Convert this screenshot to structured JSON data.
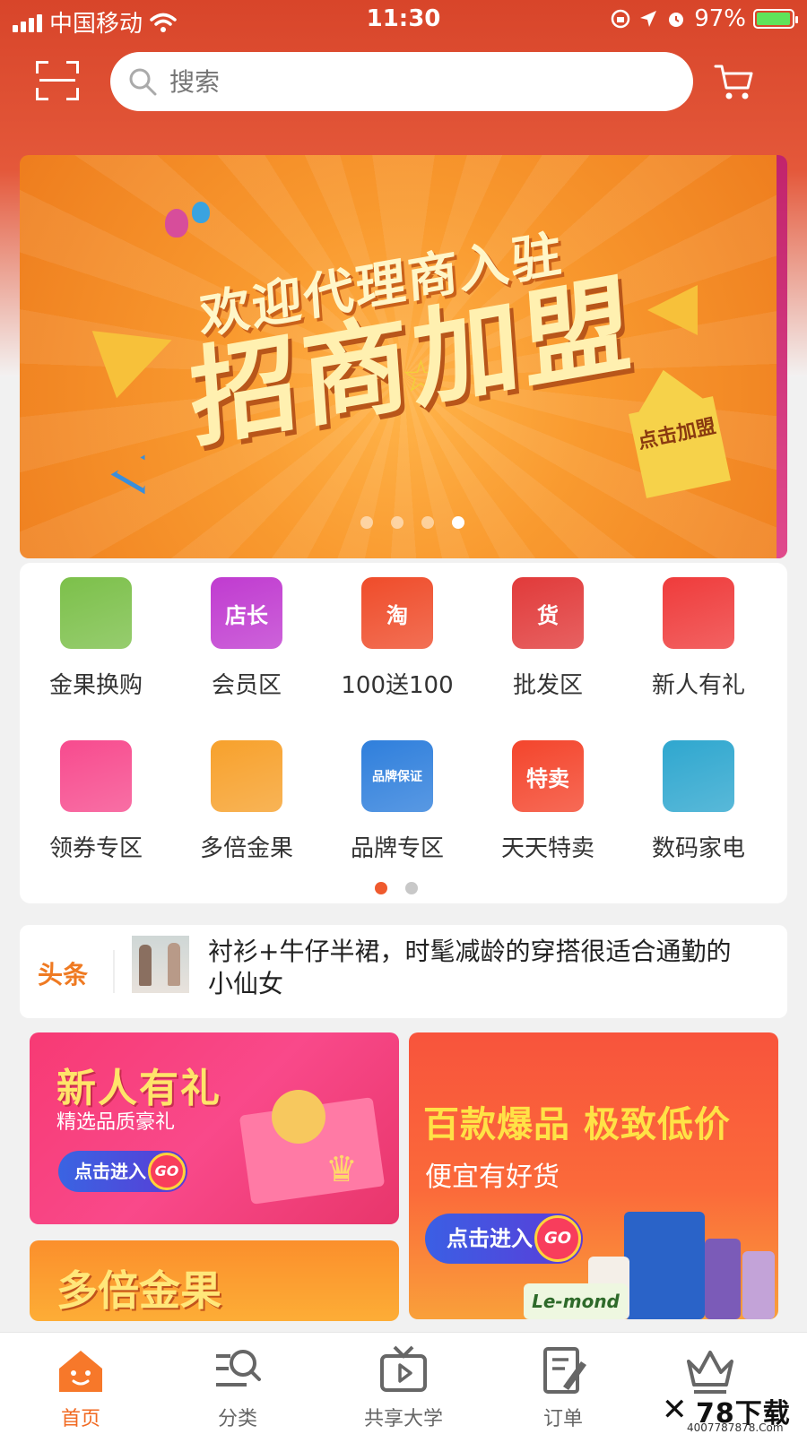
{
  "status_bar": {
    "carrier": "中国移动",
    "time": "11:30",
    "battery_percent": "97%",
    "battery_level": 0.97,
    "icons": [
      "wifi-icon",
      "orientation-lock-icon",
      "location-icon",
      "alarm-icon",
      "battery-icon"
    ]
  },
  "header": {
    "search_placeholder": "搜索",
    "icons": [
      "scan-icon",
      "search-icon",
      "cart-icon"
    ]
  },
  "banner": {
    "line1": "欢迎代理商入驻",
    "line2": "招商加盟",
    "tag": "点击加盟",
    "slide_count": 4,
    "active_slide": 4
  },
  "categories": {
    "page_count": 2,
    "active_page": 1,
    "items": [
      {
        "label": "金果换购",
        "icon": "golden-fruit-icon",
        "color": "#7cc04a"
      },
      {
        "label": "会员区",
        "icon": "store-manager-icon",
        "color": "#c03bd0",
        "badge": "店长"
      },
      {
        "label": "100送100",
        "icon": "taobao-cart-icon",
        "color": "#ef4c2a",
        "badge": "淘"
      },
      {
        "label": "批发区",
        "icon": "wholesale-icon",
        "color": "#e13a3a",
        "badge": "货"
      },
      {
        "label": "新人有礼",
        "icon": "gift-box-icon",
        "color": "#ef3b3b"
      },
      {
        "label": "领券专区",
        "icon": "coupon-icon",
        "color": "#f74b8e"
      },
      {
        "label": "多倍金果",
        "icon": "multi-fruit-icon",
        "color": "#f7a12c"
      },
      {
        "label": "品牌专区",
        "icon": "brand-medal-icon",
        "color": "#2f7fdc",
        "badge": "品牌保证"
      },
      {
        "label": "天天特卖",
        "icon": "daily-sale-icon",
        "color": "#f4452c",
        "badge": "特卖"
      },
      {
        "label": "数码家电",
        "icon": "rice-cooker-icon",
        "color": "#2fa7cf"
      }
    ]
  },
  "headline": {
    "tag": "头条",
    "text": "衬衫+牛仔半裙，时髦减龄的穿搭很适合通勤的小仙女"
  },
  "promos": {
    "new_user": {
      "title": "新人有礼",
      "subtitle": "精选品质豪礼",
      "button": "点击进入",
      "go": "GO"
    },
    "hot_items": {
      "title": "百款爆品 极致低价",
      "subtitle": "便宜有好货",
      "button": "点击进入",
      "go": "GO",
      "product_brand": "Le-mond"
    },
    "multi_fruit": {
      "title": "多倍金果"
    }
  },
  "tab_bar": {
    "active_index": 0,
    "tabs": [
      {
        "label": "首页",
        "icon": "home-icon"
      },
      {
        "label": "分类",
        "icon": "category-search-icon"
      },
      {
        "label": "共享大学",
        "icon": "tv-play-icon"
      },
      {
        "label": "订单",
        "icon": "order-edit-icon"
      },
      {
        "label": "",
        "icon": "crown-icon"
      }
    ]
  },
  "watermark": {
    "brand": "78下载",
    "url": "4007787878.Com"
  },
  "colors": {
    "accent": "#f16a22",
    "header_red": "#d8452a",
    "active_dot": "#ef5a2e"
  }
}
